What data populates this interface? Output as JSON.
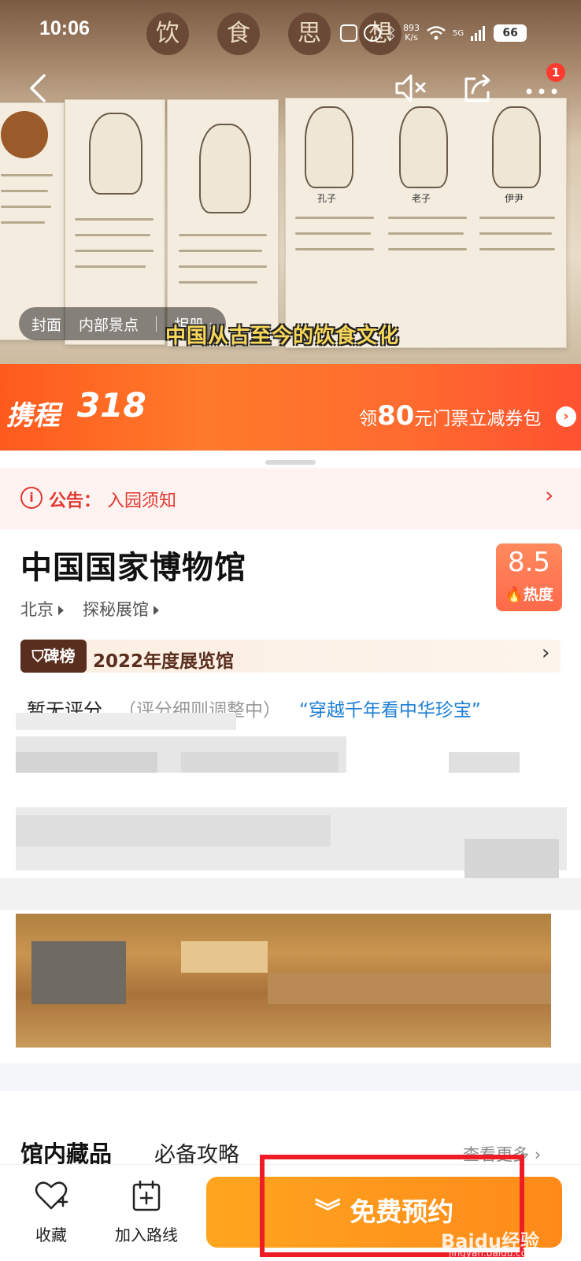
{
  "status": {
    "time": "10:06",
    "net_speed_top": "893",
    "net_speed_bottom": "K/s",
    "signal": "5G",
    "battery": "66"
  },
  "hero": {
    "roundels": [
      "饮",
      "食",
      "思",
      "想"
    ],
    "portrait_captions": [
      "孔子",
      "老子",
      "伊尹"
    ],
    "subtitle": "中国从古至今的饮食文化",
    "tabs": {
      "cover": "封面",
      "scenic": "内部景点",
      "album": "相册"
    }
  },
  "header": {
    "notification_count": "1"
  },
  "promo": {
    "brand": "携程",
    "campaign": "318",
    "text_prefix": "领",
    "amount": "80",
    "text_suffix": "元门票立减券包"
  },
  "notice": {
    "label": "公告：",
    "text": "入园须知"
  },
  "attraction": {
    "title": "中国国家博物馆",
    "heat_score": "8.5",
    "heat_label": "热度",
    "city": "北京",
    "category": "探秘展馆",
    "rank_badge": "碑榜",
    "rank_text": "2022年度展览馆",
    "score_text": "暂无评分",
    "score_note": "（评分细则调整中）",
    "slogan": "“穿越千年看中华珍宝”"
  },
  "tabs": {
    "collection": "馆内藏品",
    "guide": "必备攻略",
    "view_more": "查看更多"
  },
  "bottom_bar": {
    "favorite": "收藏",
    "add_route": "加入路线",
    "book": "免费预约"
  },
  "watermark": {
    "brand": "Baidu经验",
    "url": "jingyan.baidu.com"
  },
  "colors": {
    "accent_orange": "#ff8a1a",
    "notice_red": "#e0392f",
    "link_blue": "#1e7fd6",
    "highlight_red": "#ee1c24"
  }
}
